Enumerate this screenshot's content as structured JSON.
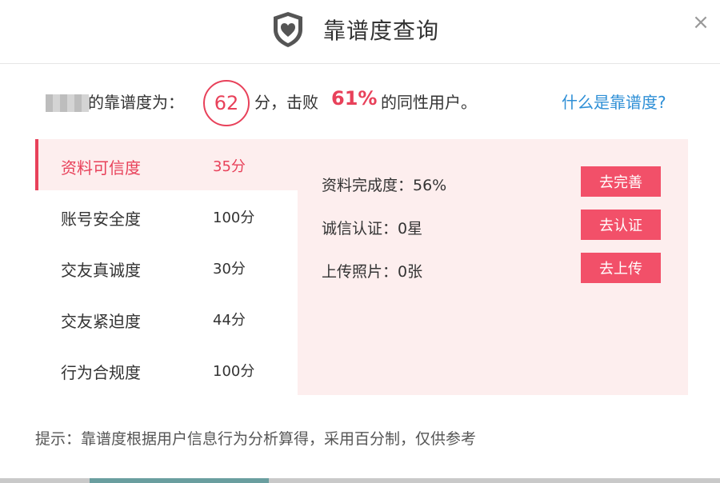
{
  "header": {
    "title": "靠谱度查询",
    "icon": "shield-heart-icon",
    "close_label": "×"
  },
  "summary": {
    "label_before": "的靠谱度为：",
    "score": "62",
    "label_middle": "分，击败",
    "beat_percent": "61%",
    "label_after": "的同性用户。",
    "help_link": "什么是靠谱度?"
  },
  "tabs": [
    {
      "name": "资料可信度",
      "score": "35分",
      "active": true
    },
    {
      "name": "账号安全度",
      "score": "100分",
      "active": false
    },
    {
      "name": "交友真诚度",
      "score": "30分",
      "active": false
    },
    {
      "name": "交友紧迫度",
      "score": "44分",
      "active": false
    },
    {
      "name": "行为合规度",
      "score": "100分",
      "active": false
    }
  ],
  "panel": {
    "rows": [
      {
        "text": "资料完成度：56%",
        "button": "去完善"
      },
      {
        "text": "诚信认证：0星",
        "button": "去认证"
      },
      {
        "text": "上传照片：0张",
        "button": "去上传"
      }
    ]
  },
  "tip": "提示：靠谱度根据用户信息行为分析算得，采用百分制，仅供参考",
  "colors": {
    "accent": "#e8415a",
    "button": "#f25069",
    "panel_bg": "#fdeeee",
    "link": "#2e8fd6"
  }
}
